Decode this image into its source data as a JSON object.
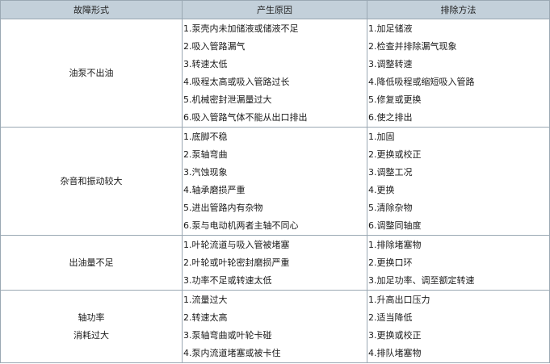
{
  "table": {
    "headers": [
      "故障形式",
      "产生原因",
      "排除方法"
    ],
    "rows": [
      {
        "symptom": [
          "油泵不出油"
        ],
        "causes": [
          "1.泵壳内未加储液或储液不足",
          "2.吸入管路漏气",
          "3.转速太低",
          "4.吸程太高或吸入管路过长",
          "5.机械密封泄漏量过大",
          "6.吸入管路气体不能从出口排出"
        ],
        "remedies": [
          "1.加足储液",
          "2.检查并排除漏气现象",
          "3.调整转速",
          "4.降低吸程或缩短吸入管路",
          "5.修复或更换",
          "6.使之排出"
        ]
      },
      {
        "symptom": [
          "杂音和振动较大"
        ],
        "causes": [
          "1.底脚不稳",
          "2.泵轴弯曲",
          "3.汽蚀现象",
          "4.轴承磨损严重",
          "5.进出管路内有杂物",
          "6.泵与电动机两者主轴不同心"
        ],
        "remedies": [
          "1.加固",
          "2.更换或校正",
          "3.调整工况",
          "4.更换",
          "5.清除杂物",
          "6.调整同轴度"
        ]
      },
      {
        "symptom": [
          "出油量不足"
        ],
        "causes": [
          "1.叶轮流道与吸入管被堵塞",
          "2.叶轮或叶轮密封磨损严重",
          "3.功率不足或转速太低"
        ],
        "remedies": [
          "1.排除堵塞物",
          "2.更换口环",
          "3.加足功率、调至额定转速"
        ]
      },
      {
        "symptom": [
          "轴功率",
          "消耗过大"
        ],
        "causes": [
          "1.流量过大",
          "2.转速太高",
          "3.泵轴弯曲或叶轮卡碰",
          "4.泵内流道堵塞或被卡住"
        ],
        "remedies": [
          "1.升高出口压力",
          "2.适当降低",
          "3.更换或校正",
          "4.排队堵塞物"
        ]
      }
    ]
  }
}
